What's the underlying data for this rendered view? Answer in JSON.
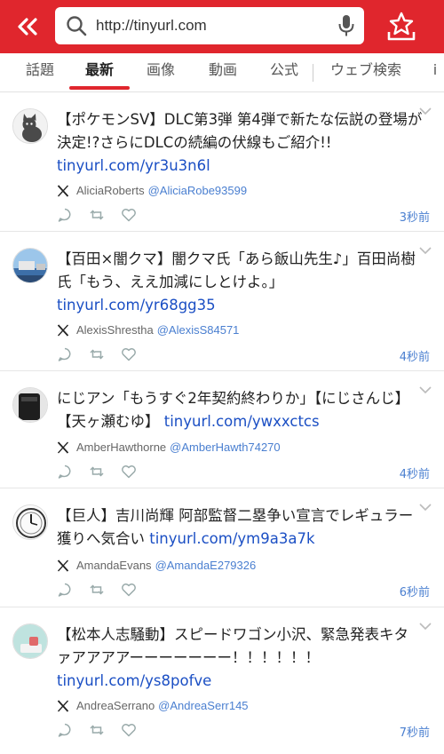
{
  "header": {
    "url": "http://tinyurl.com",
    "brand_color": "#e0262d"
  },
  "tabs": [
    {
      "label": "話題"
    },
    {
      "label": "最新"
    },
    {
      "label": "画像"
    },
    {
      "label": "動画"
    },
    {
      "label": "公式"
    },
    {
      "label": "ウェブ検索"
    },
    {
      "label": "i"
    }
  ],
  "posts": [
    {
      "text": "【ポケモンSV】DLC第3弾 第4弾で新たな伝説の登場が決定!?さらにDLCの続編の伏線もご紹介!!",
      "link": "tinyurl.com/yr3u3n6l",
      "author": "AliciaRoberts",
      "handle": "@AliciaRobe93599",
      "time": "3秒前"
    },
    {
      "text": "【百田×闇クマ】闇クマ氏「あら飯山先生♪」百田尚樹氏「もう、ええ加減にしとけよ。」",
      "link": "tinyurl.com/yr68gg35",
      "author": "AlexisShrestha",
      "handle": "@AlexisS84571",
      "time": "4秒前"
    },
    {
      "text": "にじアン「もうすぐ2年契約終わりか」【にじさんじ】【天ヶ瀬むゆ】",
      "link": "tinyurl.com/ywxxctcs",
      "author": "AmberHawthorne",
      "handle": "@AmberHawth74270",
      "time": "4秒前"
    },
    {
      "text": "【巨人】吉川尚輝 阿部監督二塁争い宣言でレギュラー獲りへ気合い",
      "link": "tinyurl.com/ym9a3a7k",
      "author": "AmandaEvans",
      "handle": "@AmandaE279326",
      "time": "6秒前"
    },
    {
      "text": "【松本人志騒動】スピードワゴン小沢、緊急発表キタァアアアアーーーーーーー！！！！！！",
      "link": "tinyurl.com/ys8pofve",
      "author": "AndreaSerrano",
      "handle": "@AndreaSerr145",
      "time": "7秒前"
    }
  ]
}
